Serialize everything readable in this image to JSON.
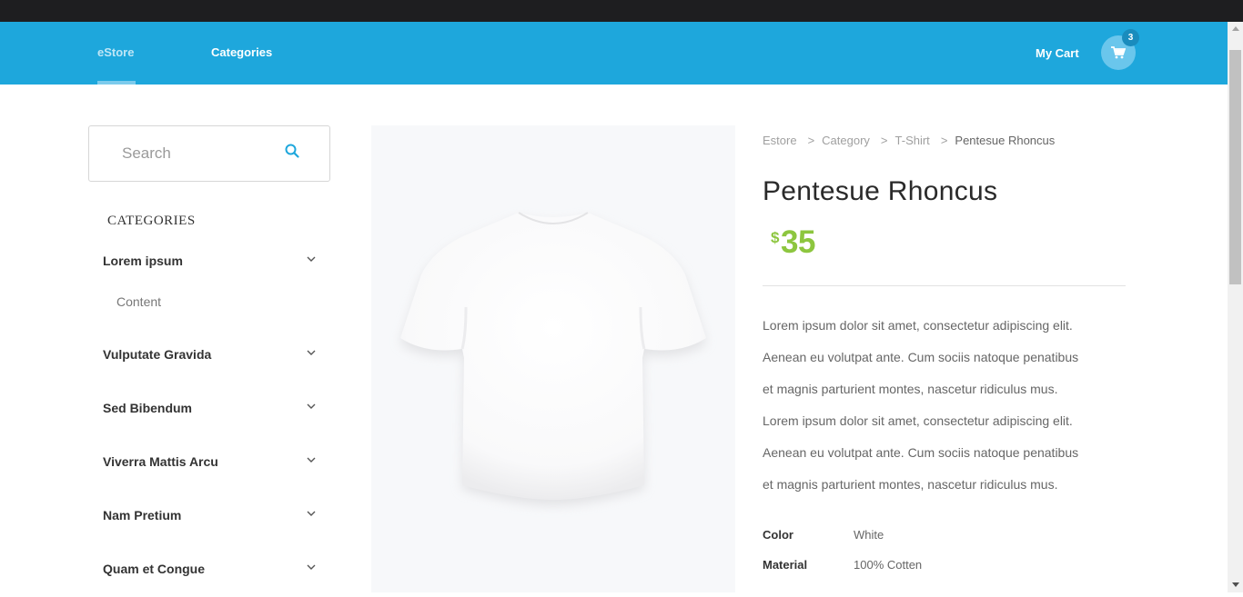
{
  "header": {
    "brand": "eStore",
    "categories_link": "Categories",
    "cart_label": "My Cart",
    "cart_count": "3",
    "accent_color": "#1ea7dc"
  },
  "sidebar": {
    "search_placeholder": "Search",
    "categories_title": "CATEGORIES",
    "items": [
      {
        "label": "Lorem ipsum",
        "sub": "Content"
      },
      {
        "label": "Vulputate Gravida"
      },
      {
        "label": "Sed Bibendum"
      },
      {
        "label": "Viverra Mattis Arcu"
      },
      {
        "label": "Nam Pretium"
      },
      {
        "label": "Quam et Congue"
      }
    ]
  },
  "breadcrumb": [
    "Estore",
    "Category",
    "T-Shirt",
    "Pentesue Rhoncus"
  ],
  "product": {
    "title": "Pentesue Rhoncus",
    "currency": "$",
    "price": "35",
    "price_color": "#8dc63f",
    "description": [
      "Lorem ipsum dolor sit amet, consectetur adipiscing elit.",
      "Aenean eu volutpat ante. Cum sociis natoque penatibus",
      "et magnis parturient montes, nascetur ridiculus mus.",
      "Lorem ipsum dolor sit amet, consectetur adipiscing elit.",
      "Aenean eu volutpat ante. Cum sociis natoque penatibus",
      "et magnis parturient montes, nascetur ridiculus mus."
    ],
    "specs": [
      {
        "key": "Color",
        "value": "White"
      },
      {
        "key": "Material",
        "value": "100% Cotten"
      }
    ]
  }
}
